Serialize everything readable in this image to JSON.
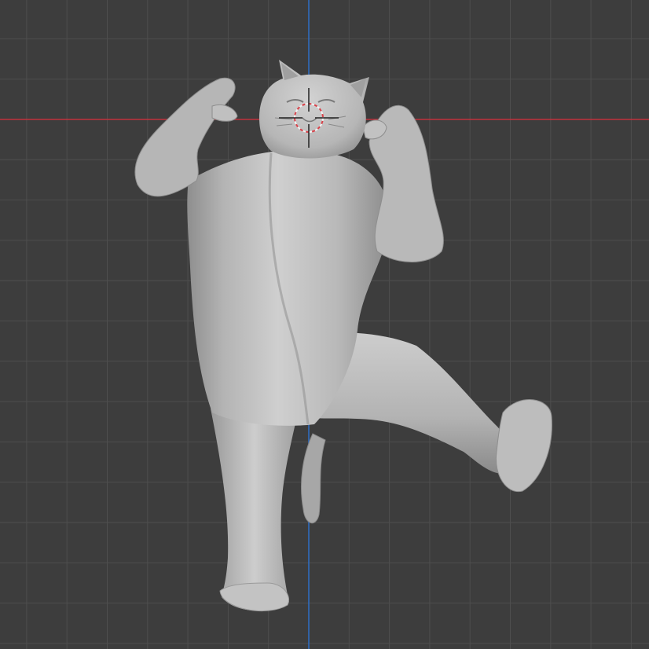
{
  "viewport": {
    "view": "3d-viewport",
    "mode": "object",
    "shading": "solid",
    "object": "dancing-cat-sculpt"
  },
  "colors": {
    "background": "#3d3d3d",
    "grid_line": "#4e4e4e",
    "x_axis": "#c2323d",
    "y_axis": "#2f6fc6",
    "mesh_light": "#c9c9c9",
    "mesh_mid": "#a9a9a9",
    "mesh_dark": "#7c7c7c",
    "cursor_red": "#d9424a",
    "cursor_white": "#f2f2f2",
    "cursor_dark": "#222222"
  },
  "icons": [
    "3d-cursor-icon"
  ]
}
